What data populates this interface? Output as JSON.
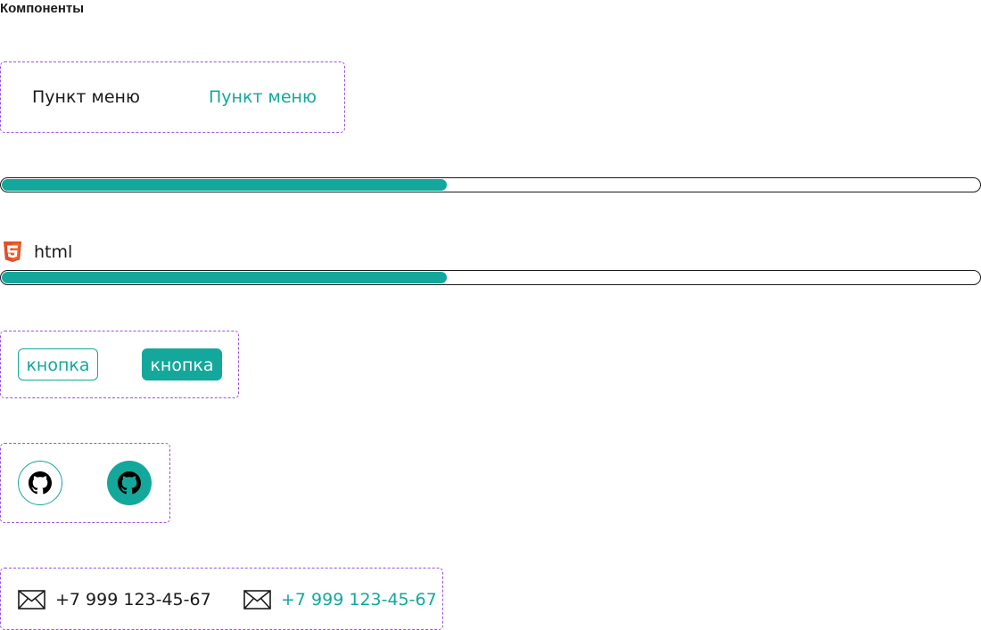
{
  "page": {
    "title": "Компоненты"
  },
  "colors": {
    "accent": "#13a89b",
    "text": "#1a1a1a",
    "dashed_border": "#9b51e0",
    "html_icon": "#e44d26"
  },
  "menu": {
    "item_default": "Пункт меню",
    "item_active": "Пункт меню"
  },
  "progress_bars": [
    {
      "level": 0.455
    },
    {
      "level": 0.455
    }
  ],
  "skill": {
    "icon": "html5-icon",
    "label": "html"
  },
  "buttons": {
    "outline_label": "кнопка",
    "filled_label": "кнопка"
  },
  "icon_buttons": {
    "outline_icon": "github-icon",
    "filled_icon": "github-icon"
  },
  "contacts": {
    "icon": "mail-icon",
    "phone_default": "+7 999 123-45-67",
    "phone_active": "+7 999 123-45-67"
  }
}
